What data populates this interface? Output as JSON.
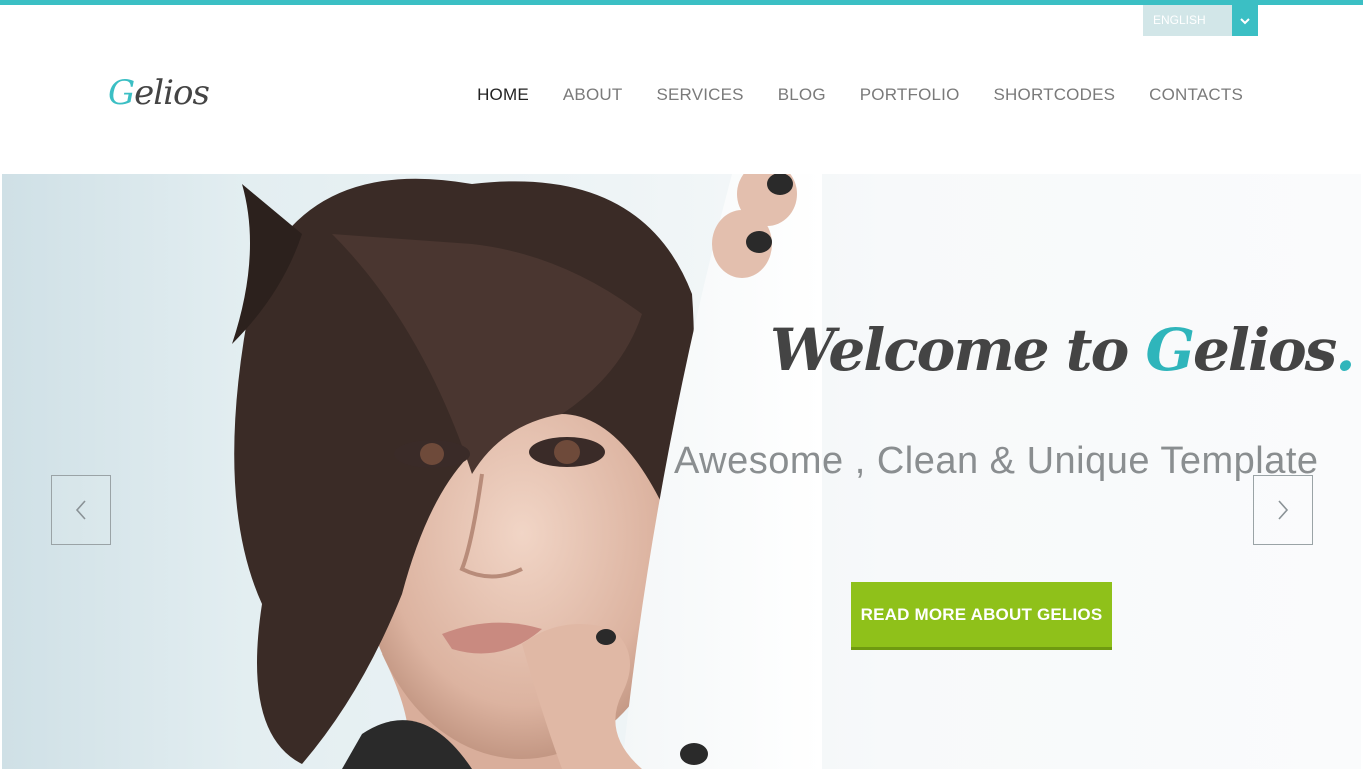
{
  "brand": {
    "logo_initial": "G",
    "logo_rest": "elios",
    "accent_color": "#3bbfc4",
    "cta_color": "#8fc11a"
  },
  "language": {
    "selected": "ENGLISH",
    "icon": "chevron-down-icon"
  },
  "nav": {
    "items": [
      {
        "label": "HOME",
        "active": true
      },
      {
        "label": "ABOUT",
        "active": false
      },
      {
        "label": "SERVICES",
        "active": false
      },
      {
        "label": "BLOG",
        "active": false
      },
      {
        "label": "PORTFOLIO",
        "active": false
      },
      {
        "label": "SHORTCODES",
        "active": false
      },
      {
        "label": "CONTACTS",
        "active": false
      }
    ]
  },
  "hero": {
    "welcome_prefix": "Welcome to ",
    "welcome_brand_initial": "G",
    "welcome_brand_rest": "elios",
    "welcome_dot": ".",
    "subtitle": "Awesome , Clean & Unique Template",
    "cta_label": "READ MORE ABOUT GELIOS",
    "prev_icon": "chevron-left-icon",
    "next_icon": "chevron-right-icon"
  }
}
